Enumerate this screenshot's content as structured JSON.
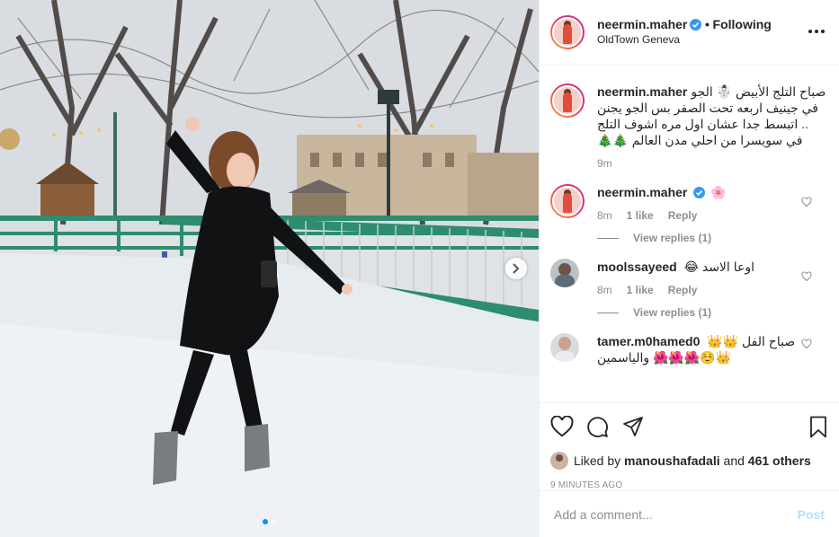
{
  "post": {
    "author": "neermin.maher",
    "follow_status": "Following",
    "separator": "•",
    "location": "OldTown Geneva"
  },
  "caption": {
    "username": "neermin.maher",
    "text": "صباح التلج الأبيض ☃️ الجو في جينيف اربعه تحت الصفر بس الجو يجنن .. اتبسط جدا عشان اول مره اشوف التلج في سويسرا من احلي مدن العالم 🎄🎄",
    "time": "9m"
  },
  "comments": [
    {
      "username": "neermin.maher",
      "text": "🌸",
      "time": "8m",
      "likes": "1 like",
      "reply": "Reply",
      "view_replies": "View replies (1)"
    },
    {
      "username": "moolssayeed",
      "text": "اوعا الاسد 😂",
      "time": "8m",
      "likes": "1 like",
      "reply": "Reply",
      "view_replies": "View replies (1)"
    },
    {
      "username": "tamer.m0hamed0",
      "text": "صباح الفل 👑👑👑☺️🌺🌺🌺 والياسمين"
    }
  ],
  "actions": {
    "liked_by_prefix": "Liked by",
    "liked_by_user": "manoushafadali",
    "liked_by_and": "and",
    "others": "461 others",
    "time_ago": "9 MINUTES AGO",
    "comment_placeholder": "Add a comment...",
    "post_label": "Post"
  },
  "icons": {
    "verified": "verified-badge-icon",
    "more": "more-options-icon",
    "like": "heart-icon",
    "comment": "comment-icon",
    "share": "share-icon",
    "save": "bookmark-icon",
    "next": "chevron-right-icon"
  },
  "colors": {
    "accent": "#0095f6",
    "verified": "#3897f0",
    "post_disabled": "#b2dffc",
    "muted": "#8e8e8e"
  },
  "carousel": {
    "count": 2,
    "active": 1
  }
}
